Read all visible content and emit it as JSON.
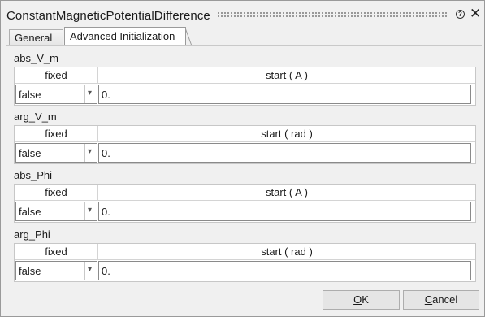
{
  "window": {
    "title": "ConstantMagneticPotentialDifference",
    "help_glyph": "?",
    "close_glyph": "✕"
  },
  "tabs": [
    {
      "label": "General",
      "active": false
    },
    {
      "label": "Advanced Initialization",
      "active": true
    }
  ],
  "groups": [
    {
      "label": "abs_V_m",
      "col_fixed": "fixed",
      "col_start": "start ( A )",
      "fixed_value": "false",
      "start_value": "0."
    },
    {
      "label": "arg_V_m",
      "col_fixed": "fixed",
      "col_start": "start ( rad )",
      "fixed_value": "false",
      "start_value": "0."
    },
    {
      "label": "abs_Phi",
      "col_fixed": "fixed",
      "col_start": "start ( A )",
      "fixed_value": "false",
      "start_value": "0."
    },
    {
      "label": "arg_Phi",
      "col_fixed": "fixed",
      "col_start": "start ( rad )",
      "fixed_value": "false",
      "start_value": "0."
    }
  ],
  "buttons": {
    "ok_mnemonic": "O",
    "ok_rest": "K",
    "cancel_mnemonic": "C",
    "cancel_rest": "ancel"
  },
  "icons": {
    "help": "help-circle-icon",
    "close": "close-icon",
    "dropdown": "chevron-down-icon"
  }
}
